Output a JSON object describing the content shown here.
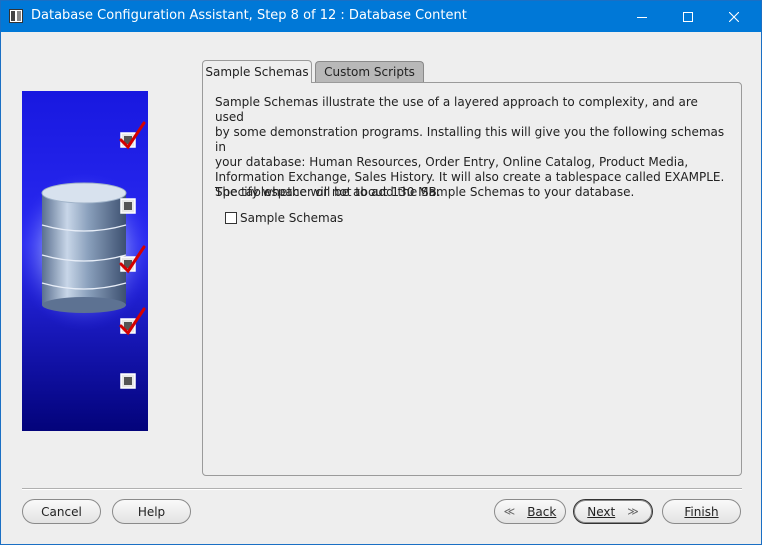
{
  "window": {
    "title": "Database Configuration Assistant, Step 8 of 12 : Database Content"
  },
  "tabs": [
    {
      "label": "Sample Schemas",
      "active": true
    },
    {
      "label": "Custom Scripts",
      "active": false
    }
  ],
  "panel": {
    "description": "Sample Schemas illustrate the use of a layered approach to complexity, and are used\nby some demonstration programs. Installing this will give you the following schemas in\nyour database: Human Resources, Order Entry, Online Catalog, Product Media,\nInformation Exchange, Sales History. It will also create a tablespace called EXAMPLE.\nThe tablespace will be about 130 MB.",
    "specify": "Specify whether or not to add the Sample Schemas to your database.",
    "checkbox_label": "Sample Schemas",
    "checkbox_checked": false
  },
  "buttons": {
    "cancel": "Cancel",
    "help": "Help",
    "back": "Back",
    "next": "Next",
    "finish": "Finish"
  },
  "art": {
    "checklist": [
      true,
      false,
      true,
      true,
      false
    ]
  },
  "colors": {
    "titlebar": "#0078d7",
    "background": "#eeeeee",
    "art_blue": "#1010d0",
    "check_red": "#d40000"
  }
}
